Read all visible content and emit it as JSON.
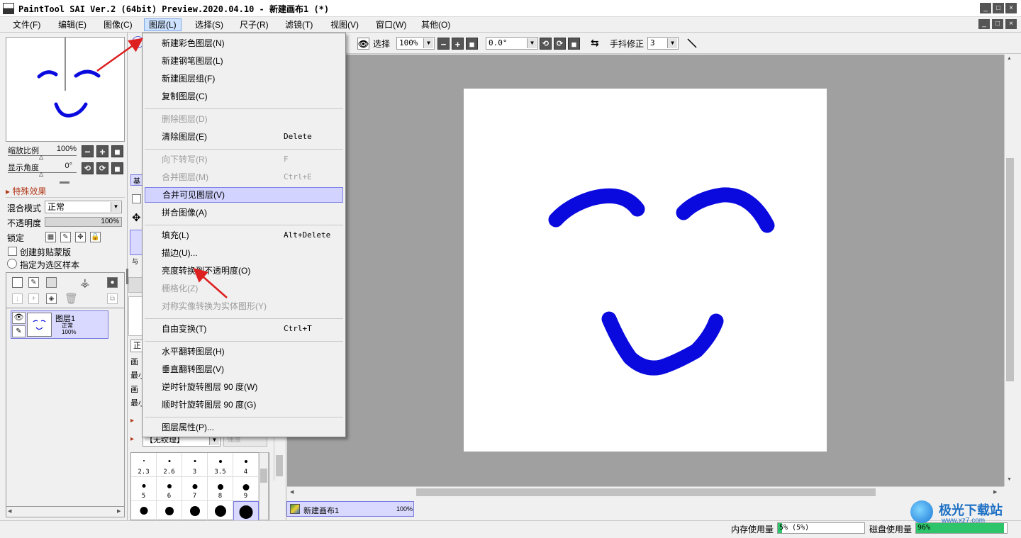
{
  "window": {
    "title": "PaintTool SAI Ver.2 (64bit) Preview.2020.04.10 - 新建画布1 (*)",
    "controls": {
      "minimize": "_",
      "maximize": "□",
      "close": "×"
    }
  },
  "menubar": {
    "items": [
      {
        "label": "文件(F)"
      },
      {
        "label": "编辑(E)"
      },
      {
        "label": "图像(C)"
      },
      {
        "label": "图层(L)"
      },
      {
        "label": "选择(S)"
      },
      {
        "label": "尺子(R)"
      },
      {
        "label": "滤镜(T)"
      },
      {
        "label": "视图(V)"
      },
      {
        "label": "窗口(W)"
      },
      {
        "label": "其他(O)"
      }
    ],
    "active_index": 3
  },
  "navigator": {
    "zoom_label": "缩放比例",
    "zoom_value": "100%",
    "angle_label": "显示角度",
    "angle_value": "0°"
  },
  "effects": {
    "header": "特殊效果",
    "blend_mode_label": "混合模式",
    "blend_mode_value": "正常",
    "opacity_label": "不透明度",
    "opacity_value": "100%",
    "opacity_fraction": 1.0,
    "lock_label": "锁定",
    "clipping_mask_label": "创建剪贴蒙版",
    "selection_source_label": "指定为选区样本"
  },
  "layers": [
    {
      "name": "图层1",
      "mode": "正常",
      "opacity": "100%"
    }
  ],
  "tool_panel": {
    "tab_fragment": "基",
    "texture_label": "【无纹理】",
    "texture_strength_placeholder": "强度",
    "partial_labels": [
      "画",
      "最小",
      "画",
      "最小"
    ],
    "blend_fragment": "正",
    "layer_fragment": "与",
    "brush_sizes": [
      "2.3",
      "2.6",
      "3",
      "3.5",
      "4",
      "5",
      "6",
      "7",
      "8",
      "9",
      "",
      "",
      "",
      "",
      ""
    ]
  },
  "toolbar": {
    "select_label": "选择",
    "zoom_value": "100%",
    "angle_value": "0.0°",
    "stabilizer_label": "手抖修正",
    "stabilizer_value": "3"
  },
  "canvas_tabs": [
    {
      "name": "新建画布1",
      "zoom": "100%"
    }
  ],
  "status": {
    "memory_label": "内存使用量",
    "memory_value": "5% (5%)",
    "memory_fraction": 0.05,
    "disk_label": "磁盘使用量",
    "disk_value": "96%",
    "disk_fraction": 0.96
  },
  "layer_menu": {
    "items": [
      {
        "label": "新建彩色图层(N)",
        "shortcut": "",
        "disabled": false
      },
      {
        "label": "新建钢笔图层(L)",
        "shortcut": "",
        "disabled": false
      },
      {
        "label": "新建图层组(F)",
        "shortcut": "",
        "disabled": false
      },
      {
        "label": "复制图层(C)",
        "shortcut": "",
        "disabled": false
      },
      {
        "label": "删除图层(D)",
        "shortcut": "",
        "disabled": true
      },
      {
        "label": "清除图层(E)",
        "shortcut": "Delete",
        "disabled": false
      },
      {
        "label": "向下转写(R)",
        "shortcut": "F",
        "disabled": true
      },
      {
        "label": "合并图层(M)",
        "shortcut": "Ctrl+E",
        "disabled": true
      },
      {
        "label": "合并可见图层(V)",
        "shortcut": "",
        "disabled": false,
        "highlight": true
      },
      {
        "label": "拼合图像(A)",
        "shortcut": "",
        "disabled": false
      },
      {
        "label": "填充(L)",
        "shortcut": "Alt+Delete",
        "disabled": false
      },
      {
        "label": "描边(U)...",
        "shortcut": "",
        "disabled": false
      },
      {
        "label": "亮度转换到不透明度(O)",
        "shortcut": "",
        "disabled": false
      },
      {
        "label": "栅格化(Z)",
        "shortcut": "",
        "disabled": true
      },
      {
        "label": "对称实像转换为实体图形(Y)",
        "shortcut": "",
        "disabled": true
      },
      {
        "label": "自由变换(T)",
        "shortcut": "Ctrl+T",
        "disabled": false
      },
      {
        "label": "水平翻转图层(H)",
        "shortcut": "",
        "disabled": false
      },
      {
        "label": "垂直翻转图层(V)",
        "shortcut": "",
        "disabled": false
      },
      {
        "label": "逆时针旋转图层 90 度(W)",
        "shortcut": "",
        "disabled": false
      },
      {
        "label": "顺时针旋转图层 90 度(G)",
        "shortcut": "",
        "disabled": false
      },
      {
        "label": "图层属性(P)...",
        "shortcut": "",
        "disabled": false
      }
    ]
  },
  "watermark": {
    "brand": "极光下载站",
    "url": "www.xz7.com"
  },
  "colors": {
    "stroke": "#0a0adf",
    "annotation_arrow": "#dd1f1f",
    "highlight": "#d2d4ff"
  }
}
